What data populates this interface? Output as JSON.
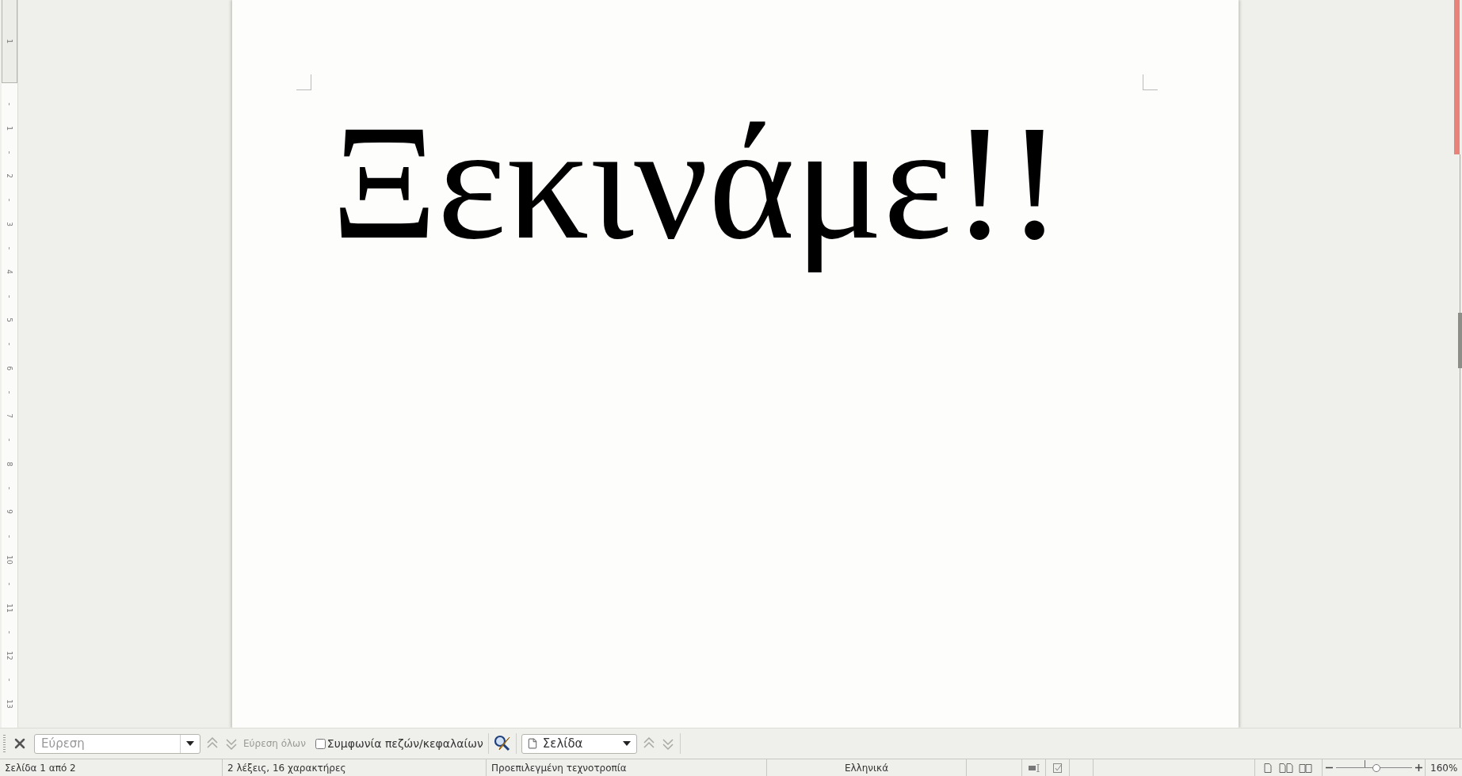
{
  "ruler": {
    "numbers": [
      "1",
      "1",
      "2",
      "3",
      "4",
      "5",
      "6",
      "7",
      "8",
      "9",
      "10",
      "11",
      "12",
      "13"
    ]
  },
  "document": {
    "text": "Ξεκινάμε!!"
  },
  "find_toolbar": {
    "search": {
      "placeholder": "Εύρεση"
    },
    "find_all": {
      "label": "Εύρεση όλων",
      "disabled": true
    },
    "match_case": {
      "label": "Συμφωνία πεζών/κεφαλαίων",
      "checked": false
    },
    "search_by": {
      "value": "Σελίδα"
    }
  },
  "status_bar": {
    "page": "Σελίδα 1 από 2",
    "words": "2 λέξεις, 16 χαρακτήρες",
    "style": "Προεπιλεγμένη τεχνοτροπία",
    "language": "Ελληνικά",
    "zoom": {
      "level": 0.54,
      "reading": "160%"
    }
  }
}
